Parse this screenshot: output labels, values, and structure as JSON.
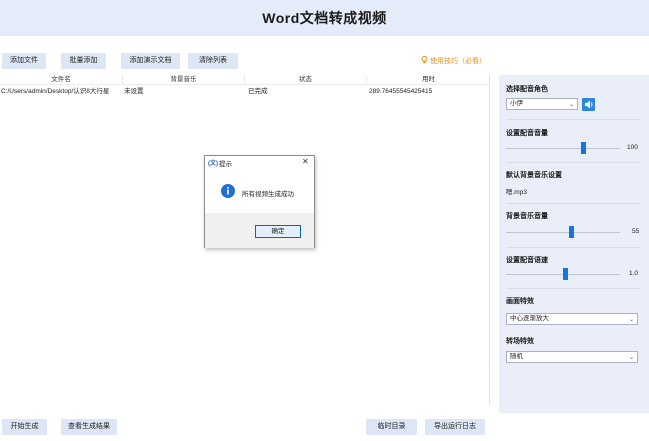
{
  "app": {
    "title": "Word文档转成视频"
  },
  "toolbar": {
    "add_file": "添加文件",
    "batch_add": "批量添加",
    "add_demo": "添加演示文档",
    "clear_list": "清除列表",
    "tips": "使用技巧（必看）"
  },
  "table": {
    "columns": [
      "文件名",
      "背景音乐",
      "状态",
      "用时"
    ],
    "rows": [
      [
        "C:/Users/admin/Desktop/认识8大行星",
        "未设置",
        "已完成",
        "289.76455545425415"
      ]
    ]
  },
  "side": {
    "voice_role_title": "选择配音角色",
    "voice_role_value": "小伊",
    "voice_volume_title": "设置配音音量",
    "voice_volume_value": "100",
    "voice_volume_level": 0.78,
    "bgm_title": "默认背景音乐设置",
    "bgm_value": "嗯.mp3",
    "bgm_volume_title": "背景音乐音量",
    "bgm_volume_value": "55",
    "bgm_volume_level": 0.55,
    "speed_title": "设置配音语速",
    "speed_value": "1.0",
    "speed_level": 0.5,
    "screen_effect_title": "画面特效",
    "screen_effect_value": "中心逐渐放大",
    "transition_title": "转场特效",
    "transition_value": "随机"
  },
  "dialog": {
    "title": "提示",
    "message": "所有视频生成成功",
    "ok_label": "确定"
  },
  "footer": {
    "start": "开始生成",
    "view_result": "查看生成结果",
    "temp_dir": "临时目录",
    "export_log": "导出运行日志"
  },
  "colors": {
    "header_bg": "#e4ecf9",
    "button_bg": "#dce6f4",
    "accent": "#1a73d9",
    "tips": "#e8911c",
    "panel_bg": "#e9eef8"
  }
}
